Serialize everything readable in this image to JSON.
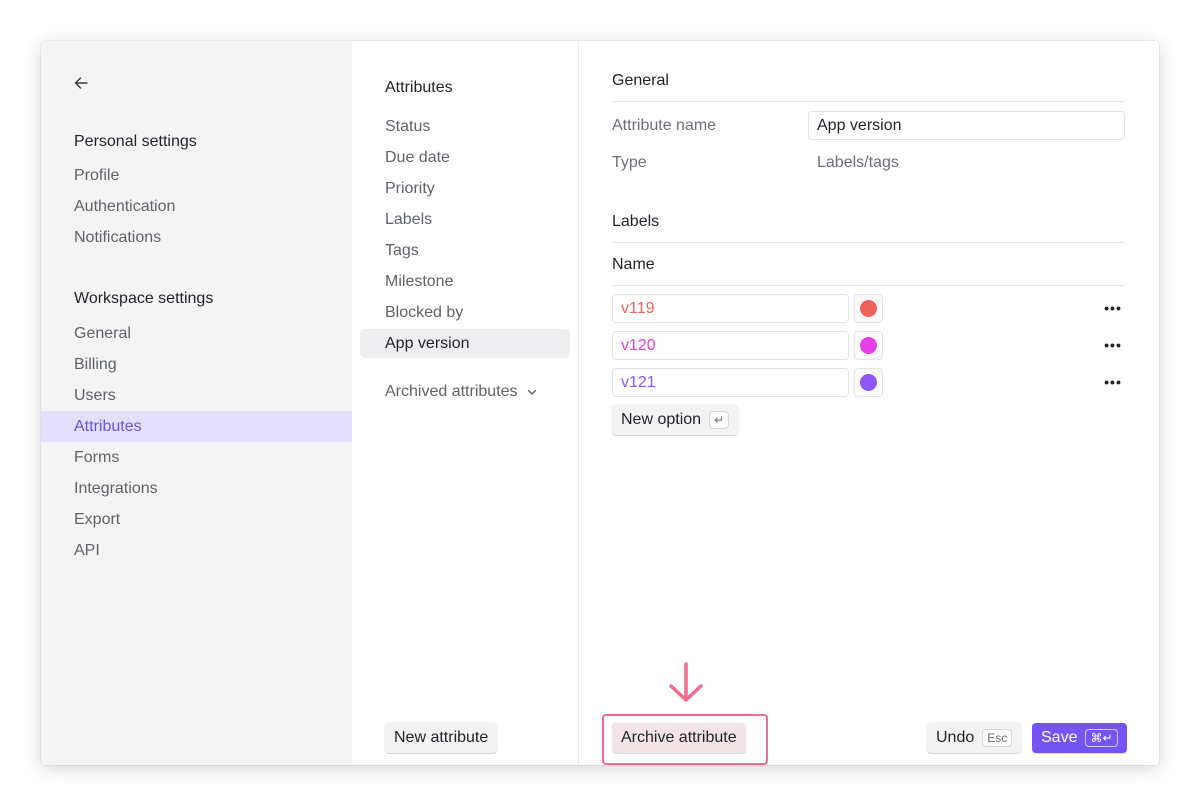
{
  "nav": {
    "back_icon": "arrow-left-icon",
    "personal_title": "Personal settings",
    "personal_items": [
      "Profile",
      "Authentication",
      "Notifications"
    ],
    "workspace_title": "Workspace settings",
    "workspace_items": [
      "General",
      "Billing",
      "Users",
      "Attributes",
      "Forms",
      "Integrations",
      "Export",
      "API"
    ],
    "active_item": "Attributes"
  },
  "attributes": {
    "title": "Attributes",
    "items": [
      "Status",
      "Due date",
      "Priority",
      "Labels",
      "Tags",
      "Milestone",
      "Blocked by",
      "App version"
    ],
    "active_item": "App version",
    "archived_label": "Archived attributes",
    "new_attribute_label": "New attribute"
  },
  "detail": {
    "general_title": "General",
    "name_label": "Attribute name",
    "name_value": "App version",
    "type_label": "Type",
    "type_value": "Labels/tags",
    "labels_title": "Labels",
    "name_column": "Name",
    "options": [
      {
        "value": "v119",
        "color": "#f0625a"
      },
      {
        "value": "v120",
        "color": "#e23fe6"
      },
      {
        "value": "v121",
        "color": "#8f57f4"
      }
    ],
    "new_option_label": "New option",
    "new_option_key": "↵",
    "archive_label": "Archive attribute",
    "undo_label": "Undo",
    "undo_key": "Esc",
    "save_label": "Save",
    "save_key": "⌘↵"
  },
  "colors": {
    "accent": "#7455f3",
    "active_nav_bg": "#e4e0fb",
    "active_nav_text": "#6b4ee6",
    "annotation": "#f36b8d"
  }
}
